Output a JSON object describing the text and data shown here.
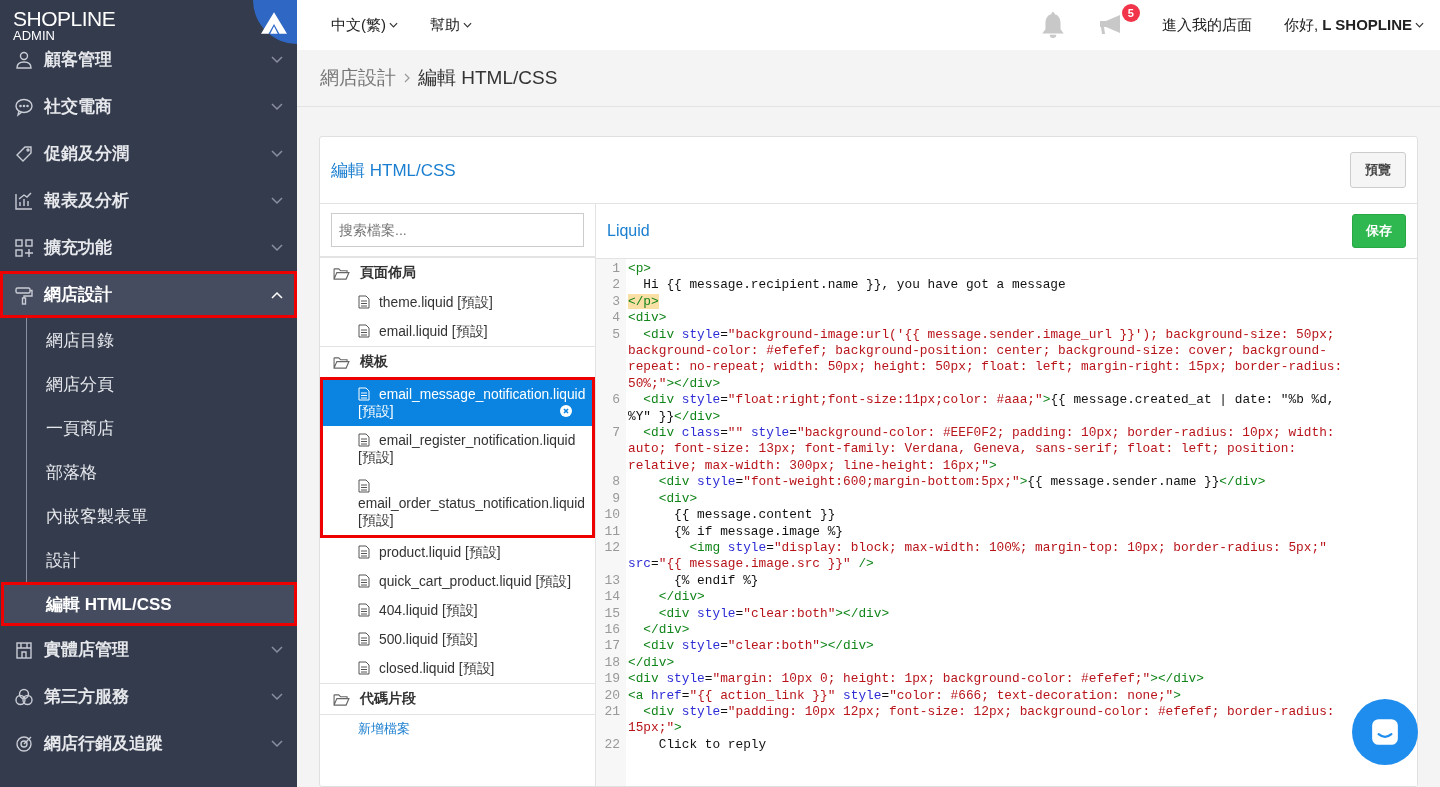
{
  "logo": {
    "brand": "**SHOP**LINE",
    "sub": "ADMIN"
  },
  "sidebar": {
    "items": [
      {
        "label": "顧客管理",
        "expanded": false,
        "selected": false,
        "highlighted": false
      },
      {
        "label": "社交電商",
        "expanded": false,
        "selected": false,
        "highlighted": false
      },
      {
        "label": "促銷及分潤",
        "expanded": false,
        "selected": false,
        "highlighted": false
      },
      {
        "label": "報表及分析",
        "expanded": false,
        "selected": false,
        "highlighted": false
      },
      {
        "label": "擴充功能",
        "expanded": false,
        "selected": false,
        "highlighted": false
      },
      {
        "label": "網店設計",
        "expanded": true,
        "selected": true,
        "highlighted": true,
        "children": [
          {
            "label": "網店目錄",
            "selected": false,
            "highlighted": false
          },
          {
            "label": "網店分頁",
            "selected": false,
            "highlighted": false
          },
          {
            "label": "一頁商店",
            "selected": false,
            "highlighted": false
          },
          {
            "label": "部落格",
            "selected": false,
            "highlighted": false
          },
          {
            "label": "內嵌客製表單",
            "selected": false,
            "highlighted": false
          },
          {
            "label": "設計",
            "selected": false,
            "highlighted": false
          },
          {
            "label": "編輯 HTML/CSS",
            "selected": true,
            "highlighted": true
          }
        ]
      },
      {
        "label": "實體店管理",
        "expanded": false,
        "selected": false,
        "highlighted": false
      },
      {
        "label": "第三方服務",
        "expanded": false,
        "selected": false,
        "highlighted": false
      },
      {
        "label": "網店行銷及追蹤",
        "expanded": false,
        "selected": false,
        "highlighted": false
      }
    ]
  },
  "topbar": {
    "language": "中文(繁)",
    "help": "幫助",
    "notification_count": "5",
    "storefront": "進入我的店面",
    "greeting": "你好, **L SHOPLINE**"
  },
  "breadcrumb": [
    {
      "label": "網店設計"
    },
    {
      "label": "編輯 HTML/CSS"
    }
  ],
  "panel": {
    "title": "編輯 HTML/CSS",
    "preview_button": "預覽"
  },
  "files": {
    "search": {
      "placeholder": "搜索檔案..."
    },
    "sections": [
      {
        "title": "頁面佈局",
        "items": [
          {
            "name": "theme.liquid [預設]",
            "selected": false,
            "highlighted": false
          },
          {
            "name": "email.liquid [預設]",
            "selected": false,
            "highlighted": false
          }
        ]
      },
      {
        "title": "模板",
        "items": [
          {
            "name": "email_message_notification.liquid [預設]",
            "selected": true,
            "highlighted": true
          },
          {
            "name": "email_register_notification.liquid [預設]",
            "selected": false,
            "highlighted": true
          },
          {
            "name": "email_order_status_notification.liquid [預設]",
            "selected": false,
            "highlighted": true
          },
          {
            "name": "product.liquid [預設]",
            "selected": false,
            "highlighted": false
          },
          {
            "name": "quick_cart_product.liquid [預設]",
            "selected": false,
            "highlighted": false
          },
          {
            "name": "404.liquid [預設]",
            "selected": false,
            "highlighted": false
          },
          {
            "name": "500.liquid [預設]",
            "selected": false,
            "highlighted": false
          },
          {
            "name": "closed.liquid [預設]",
            "selected": false,
            "highlighted": false
          }
        ]
      },
      {
        "title": "代碼片段",
        "add_link": "新增檔案"
      }
    ]
  },
  "editor": {
    "title": "Liquid",
    "save_button": "保存",
    "lines": [
      {
        "number": "1",
        "segments": [
          {
            "kind": "tag",
            "text": "<p>"
          }
        ]
      },
      {
        "number": "2",
        "segments": [
          {
            "kind": "text",
            "text": "  Hi {{ message.recipient.name }}, you have got a message"
          }
        ]
      },
      {
        "number": "3",
        "segments": [
          {
            "kind": "tag",
            "text": "</p>",
            "highlighted": true
          }
        ]
      },
      {
        "number": "4",
        "segments": [
          {
            "kind": "tag",
            "text": "<div>"
          }
        ]
      },
      {
        "number": "5",
        "segments": [
          {
            "kind": "tag",
            "text": "  <div"
          },
          {
            "kind": "attr",
            "text": " style"
          },
          {
            "kind": "text",
            "text": "="
          },
          {
            "kind": "string",
            "text": "\"background-image:url('{{ message.sender.image_url }}'); background-size: 50px; background-color: #efefef; background-position: center; background-size: cover; background-repeat: no-repeat; width: 50px; height: 50px; float: left; margin-right: 15px; border-radius: 50%;\""
          },
          {
            "kind": "tag",
            "text": "></div>"
          }
        ]
      },
      {
        "number": "6",
        "segments": [
          {
            "kind": "tag",
            "text": "  <div"
          },
          {
            "kind": "attr",
            "text": " style"
          },
          {
            "kind": "text",
            "text": "="
          },
          {
            "kind": "string",
            "text": "\"float:right;font-size:11px;color: #aaa;\""
          },
          {
            "kind": "tag",
            "text": ">"
          },
          {
            "kind": "text",
            "text": "{{ message.created_at | date: \"%b %d, %Y\" }}"
          },
          {
            "kind": "tag",
            "text": "</div>"
          }
        ]
      },
      {
        "number": "7",
        "segments": [
          {
            "kind": "tag",
            "text": "  <div"
          },
          {
            "kind": "attr",
            "text": " class"
          },
          {
            "kind": "text",
            "text": "="
          },
          {
            "kind": "string",
            "text": "\"\""
          },
          {
            "kind": "attr",
            "text": " style"
          },
          {
            "kind": "text",
            "text": "="
          },
          {
            "kind": "string",
            "text": "\"background-color: #EEF0F2; padding: 10px; border-radius: 10px; width: auto; font-size: 13px; font-family: Verdana, Geneva, sans-serif; float: left; position: relative; max-width: 300px; line-height: 16px;\""
          },
          {
            "kind": "tag",
            "text": ">"
          }
        ]
      },
      {
        "number": "8",
        "segments": [
          {
            "kind": "tag",
            "text": "    <div"
          },
          {
            "kind": "attr",
            "text": " style"
          },
          {
            "kind": "text",
            "text": "="
          },
          {
            "kind": "string",
            "text": "\"font-weight:600;margin-bottom:5px;\""
          },
          {
            "kind": "tag",
            "text": ">"
          },
          {
            "kind": "text",
            "text": "{{ message.sender.name }}"
          },
          {
            "kind": "tag",
            "text": "</div>"
          }
        ]
      },
      {
        "number": "9",
        "segments": [
          {
            "kind": "tag",
            "text": "    <div>"
          }
        ]
      },
      {
        "number": "10",
        "segments": [
          {
            "kind": "text",
            "text": "      {{ message.content }}"
          }
        ]
      },
      {
        "number": "11",
        "segments": [
          {
            "kind": "text",
            "text": "      {% if message.image %}"
          }
        ]
      },
      {
        "number": "12",
        "segments": [
          {
            "kind": "tag",
            "text": "        <img"
          },
          {
            "kind": "attr",
            "text": " style"
          },
          {
            "kind": "text",
            "text": "="
          },
          {
            "kind": "string",
            "text": "\"display: block; max-width: 100%; margin-top: 10px; border-radius: 5px;\""
          },
          {
            "kind": "attr",
            "text": " src"
          },
          {
            "kind": "text",
            "text": "="
          },
          {
            "kind": "string",
            "text": "\"{{ message.image.src }}\""
          },
          {
            "kind": "tag",
            "text": " />"
          }
        ]
      },
      {
        "number": "13",
        "segments": [
          {
            "kind": "text",
            "text": "      {% endif %}"
          }
        ]
      },
      {
        "number": "14",
        "segments": [
          {
            "kind": "tag",
            "text": "    </div>"
          }
        ]
      },
      {
        "number": "15",
        "segments": [
          {
            "kind": "tag",
            "text": "    <div"
          },
          {
            "kind": "attr",
            "text": " style"
          },
          {
            "kind": "text",
            "text": "="
          },
          {
            "kind": "string",
            "text": "\"clear:both\""
          },
          {
            "kind": "tag",
            "text": "></div>"
          }
        ]
      },
      {
        "number": "16",
        "segments": [
          {
            "kind": "tag",
            "text": "  </div>"
          }
        ]
      },
      {
        "number": "17",
        "segments": [
          {
            "kind": "tag",
            "text": "  <div"
          },
          {
            "kind": "attr",
            "text": " style"
          },
          {
            "kind": "text",
            "text": "="
          },
          {
            "kind": "string",
            "text": "\"clear:both\""
          },
          {
            "kind": "tag",
            "text": "></div>"
          }
        ]
      },
      {
        "number": "18",
        "segments": [
          {
            "kind": "tag",
            "text": "</div>"
          }
        ]
      },
      {
        "number": "19",
        "segments": [
          {
            "kind": "tag",
            "text": "<div"
          },
          {
            "kind": "attr",
            "text": " style"
          },
          {
            "kind": "text",
            "text": "="
          },
          {
            "kind": "string",
            "text": "\"margin: 10px 0; height: 1px; background-color: #efefef;\""
          },
          {
            "kind": "tag",
            "text": "></div>"
          }
        ]
      },
      {
        "number": "20",
        "segments": [
          {
            "kind": "tag",
            "text": "<a"
          },
          {
            "kind": "attr",
            "text": " href"
          },
          {
            "kind": "text",
            "text": "="
          },
          {
            "kind": "string",
            "text": "\"{{ action_link }}\""
          },
          {
            "kind": "attr",
            "text": " style"
          },
          {
            "kind": "text",
            "text": "="
          },
          {
            "kind": "string",
            "text": "\"color: #666; text-decoration: none;\""
          },
          {
            "kind": "tag",
            "text": ">"
          }
        ]
      },
      {
        "number": "21",
        "segments": [
          {
            "kind": "tag",
            "text": "  <div"
          },
          {
            "kind": "attr",
            "text": " style"
          },
          {
            "kind": "text",
            "text": "="
          },
          {
            "kind": "string",
            "text": "\"padding: 10px 12px; font-size: 12px; background-color: #efefef; border-radius: 15px;\""
          },
          {
            "kind": "tag",
            "text": ">"
          }
        ]
      },
      {
        "number": "22",
        "segments": [
          {
            "kind": "text",
            "text": "    Click to reply"
          }
        ]
      }
    ]
  }
}
